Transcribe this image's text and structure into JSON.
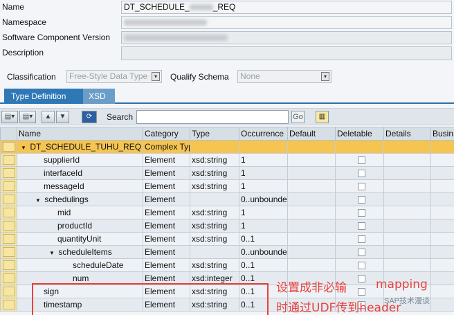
{
  "header": {
    "name_label": "Name",
    "name_value_prefix": "DT_SCHEDULE_",
    "name_value_suffix": "_REQ",
    "namespace_label": "Namespace",
    "swcv_label": "Software Component Version",
    "description_label": "Description"
  },
  "classification": {
    "label": "Classification",
    "value": "Free-Style Data Type",
    "qualify_label": "Qualify Schema",
    "qualify_value": "None"
  },
  "tabs": [
    {
      "label": "Type Definition",
      "active": true
    },
    {
      "label": "XSD",
      "active": false
    }
  ],
  "toolbar": {
    "search_label": "Search",
    "go_label": "Go"
  },
  "table": {
    "columns": [
      "Name",
      "Category",
      "Type",
      "Occurrence",
      "Default",
      "Deletable",
      "Details",
      "Busin"
    ],
    "rows": [
      {
        "name": "DT_SCHEDULE_TUHU_REQ",
        "category": "Complex Typ",
        "type": "",
        "occurrence": "",
        "deletable": false,
        "level": 0,
        "toggle": "▼",
        "selected": true
      },
      {
        "name": "supplierId",
        "category": "Element",
        "type": "xsd:string",
        "occurrence": "1",
        "deletable": true,
        "level": 1,
        "toggle": "",
        "selected": false
      },
      {
        "name": "interfaceId",
        "category": "Element",
        "type": "xsd:string",
        "occurrence": "1",
        "deletable": true,
        "level": 1,
        "toggle": "",
        "selected": false
      },
      {
        "name": "messageId",
        "category": "Element",
        "type": "xsd:string",
        "occurrence": "1",
        "deletable": true,
        "level": 1,
        "toggle": "",
        "selected": false
      },
      {
        "name": "schedulings",
        "category": "Element",
        "type": "",
        "occurrence": "0..unbounde",
        "deletable": true,
        "level": 1,
        "toggle": "▼",
        "selected": false
      },
      {
        "name": "mid",
        "category": "Element",
        "type": "xsd:string",
        "occurrence": "1",
        "deletable": true,
        "level": 2,
        "toggle": "",
        "selected": false
      },
      {
        "name": "productId",
        "category": "Element",
        "type": "xsd:string",
        "occurrence": "1",
        "deletable": true,
        "level": 2,
        "toggle": "",
        "selected": false
      },
      {
        "name": "quantityUnit",
        "category": "Element",
        "type": "xsd:string",
        "occurrence": "0..1",
        "deletable": true,
        "level": 2,
        "toggle": "",
        "selected": false
      },
      {
        "name": "scheduleItems",
        "category": "Element",
        "type": "",
        "occurrence": "0..unbounde",
        "deletable": true,
        "level": 2,
        "toggle": "▼",
        "selected": false
      },
      {
        "name": "scheduleDate",
        "category": "Element",
        "type": "xsd:string",
        "occurrence": "0..1",
        "deletable": true,
        "level": 3,
        "toggle": "",
        "selected": false
      },
      {
        "name": "num",
        "category": "Element",
        "type": "xsd:integer",
        "occurrence": "0..1",
        "deletable": true,
        "level": 3,
        "toggle": "",
        "selected": false
      },
      {
        "name": "sign",
        "category": "Element",
        "type": "xsd:string",
        "occurrence": "0..1",
        "deletable": true,
        "level": 1,
        "toggle": "",
        "selected": false
      },
      {
        "name": "timestamp",
        "category": "Element",
        "type": "xsd:string",
        "occurrence": "0..1",
        "deletable": true,
        "level": 1,
        "toggle": "",
        "selected": false
      }
    ]
  },
  "annotation": {
    "line1": "设置成非必输",
    "line1_right": "mapping",
    "line2": "时通过UDF传到header",
    "color": "#e8413c"
  },
  "watermark": "SAP技术漫谈"
}
